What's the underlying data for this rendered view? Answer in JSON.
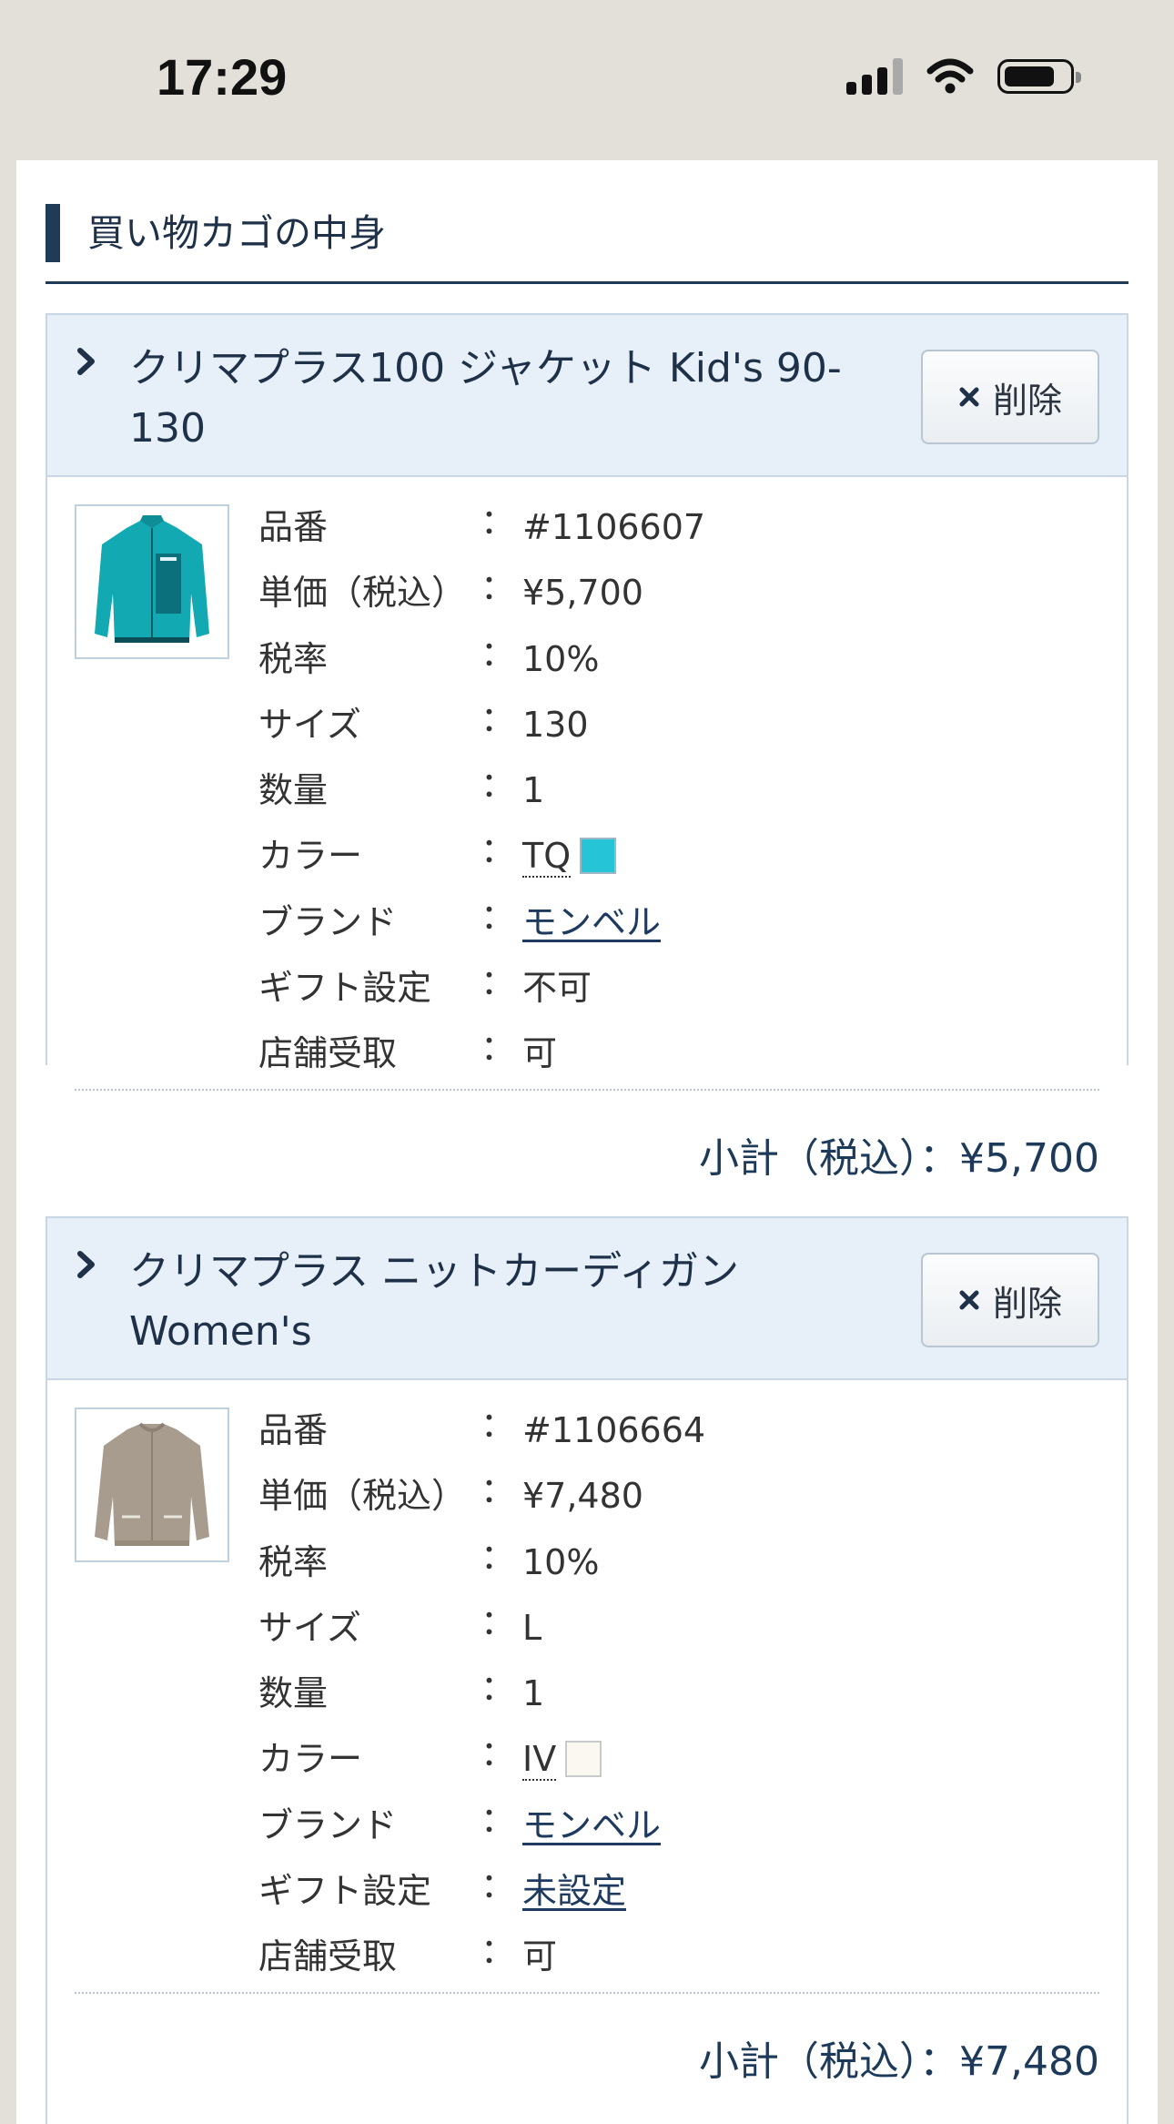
{
  "status": {
    "time": "17:29"
  },
  "heading": {
    "title": "買い物カゴの中身"
  },
  "labels": {
    "part_no": "品番",
    "unit_price": "単価（税込）",
    "tax_rate": "税率",
    "size": "サイズ",
    "quantity": "数量",
    "color": "カラー",
    "brand": "ブランド",
    "gift": "ギフト設定",
    "store_pickup": "店舗受取",
    "colon": "："
  },
  "delete_label": "削除",
  "items": [
    {
      "title": "クリマプラス100 ジャケット Kid's 90-130",
      "part_no": "#1106607",
      "unit_price": "¥5,700",
      "tax_rate": "10%",
      "size": "130",
      "quantity": "1",
      "color_code": "TQ",
      "color_hex": "#25c4d7",
      "brand": "モンベル",
      "gift": "不可",
      "store_pickup": "可",
      "subtotal": "小計（税込）：¥5,700"
    },
    {
      "title": "クリマプラス ニットカーディガン Women's",
      "part_no": "#1106664",
      "unit_price": "¥7,480",
      "tax_rate": "10%",
      "size": "L",
      "quantity": "1",
      "color_code": "IV",
      "color_hex": "#fbf8f1",
      "brand": "モンベル",
      "gift": "未設定",
      "store_pickup": "可",
      "subtotal": "小計（税込）：¥7,480"
    }
  ]
}
